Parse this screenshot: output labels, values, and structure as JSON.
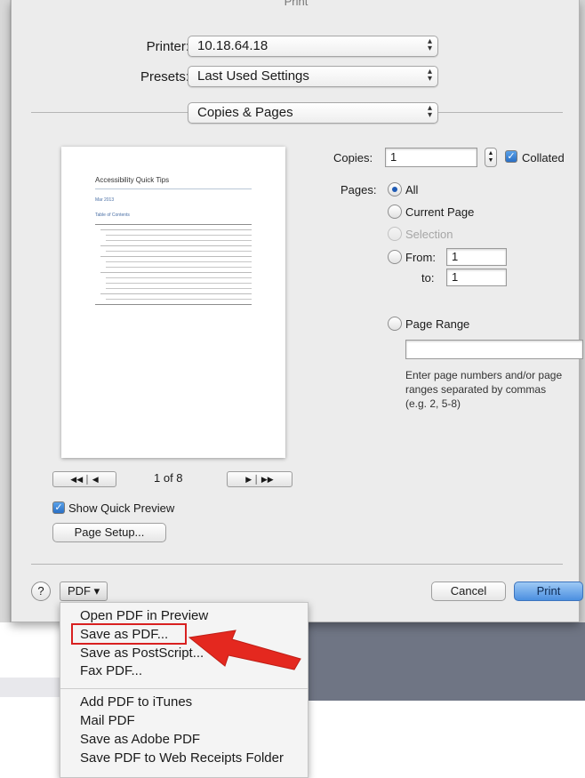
{
  "dialog": {
    "title": "Print"
  },
  "printer": {
    "label": "Printer:",
    "value": "10.18.64.18"
  },
  "presets": {
    "label": "Presets:",
    "value": "Last Used Settings"
  },
  "section": {
    "value": "Copies & Pages"
  },
  "preview": {
    "doc_title": "Accessibility Quick Tips",
    "doc_date": "Mar 2013",
    "doc_toc": "Table of Contents",
    "page_indicator": "1 of 8",
    "show_quick_preview": "Show Quick Preview",
    "page_setup": "Page Setup..."
  },
  "copies": {
    "label": "Copies:",
    "value": "1",
    "collated_label": "Collated"
  },
  "pages": {
    "label": "Pages:",
    "all": "All",
    "current_page": "Current Page",
    "selection": "Selection",
    "from_label": "From:",
    "from_value": "1",
    "to_label": "to:",
    "to_value": "1",
    "page_range": "Page Range",
    "range_value": "",
    "hint": "Enter page numbers and/or page ranges separated by commas (e.g. 2, 5-8)"
  },
  "footer": {
    "help": "?",
    "pdf": "PDF ▾",
    "cancel": "Cancel",
    "print": "Print"
  },
  "pdf_menu": {
    "items": [
      "Open PDF in Preview",
      "Save as PDF...",
      "Save as PostScript...",
      "Fax PDF...",
      "Add PDF to iTunes",
      "Mail PDF",
      "Save as Adobe PDF",
      "Save PDF to Web Receipts Folder"
    ]
  },
  "icons": {
    "checkmark": "checkmark-icon",
    "arrow": "red-arrow-annotation"
  },
  "colors": {
    "accent_blue": "#2a6fc4",
    "annotation_red": "#d82020"
  }
}
